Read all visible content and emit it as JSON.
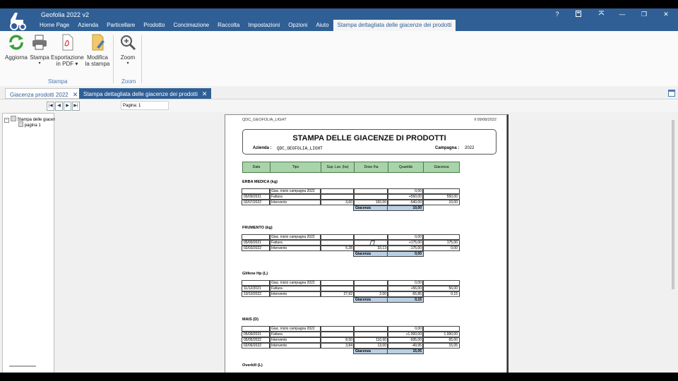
{
  "app": {
    "title": "Geofolia 2022 v2"
  },
  "menu": [
    "Home Page",
    "Azienda",
    "Particellare",
    "Prodotto",
    "Concimazione",
    "Raccolta",
    "Impostazioni",
    "Opzioni",
    "Aiuto",
    "Stampa dettagliata delle giacenze dei prodotti"
  ],
  "window_controls": {
    "help": "?",
    "minimize": "—",
    "restore": "❐",
    "close": "✕"
  },
  "ribbon": {
    "refresh": "Aggiorna",
    "print": "Stampa",
    "export_pdf_1": "Esportazione",
    "export_pdf_2": "in PDF ▾",
    "edit_print_1": "Modifica",
    "edit_print_2": "la stampa",
    "zoom": "Zoom",
    "group_print": "Stampa",
    "group_zoom": "Zoom"
  },
  "tabs": {
    "tab1": "Giacenza prodotti 2022",
    "tab2": "Stampa dettagliata delle giacenze dei prodotti"
  },
  "viewer": {
    "page_label": "Pagina: 1"
  },
  "tree": {
    "root": "Stampa delle giacenze",
    "child": "pagina 1"
  },
  "report": {
    "db_name": "QDC_GEOFOLIA_LIGHT",
    "date": "Il 09/08/2022",
    "title": "STAMPA DELLE GIACENZE DI PRODOTTI",
    "azienda_label": "Azienda :",
    "azienda_value": "QDC_GEOFOLIA_LIGHT",
    "campagna_label": "Campagna :",
    "campagna_value": "2022",
    "columns": [
      "Data",
      "Tipo",
      "Sup. Lav. (ha)",
      "Dose /ha",
      "Quantità",
      "Giacenza"
    ],
    "total_label": "Giacenza",
    "sections": [
      {
        "name": "ERBA MEDICA (kg)",
        "rows": [
          [
            "",
            "Giac. inizio campagna 2022",
            "",
            "",
            "0,00",
            ""
          ],
          [
            "05/09/2021",
            "Fattura",
            "",
            "",
            "+550,00",
            "550,00"
          ],
          [
            "02/07/2022",
            "Intervento",
            "3,60",
            "150,00",
            "-540,00",
            "10,00"
          ]
        ],
        "total": "10,00"
      },
      {
        "name": "FRUMENTO (kg)",
        "rows": [
          [
            "",
            "Giac. inizio campagna 2022",
            "",
            "",
            "0,00",
            ""
          ],
          [
            "05/09/2021",
            "Fattura",
            "",
            "",
            "+175,00",
            "175,00"
          ],
          [
            "02/03/2022",
            "Intervento",
            "5,28",
            "33,13",
            "-175,00",
            "0,00"
          ]
        ],
        "total": "0,00"
      },
      {
        "name": "Glifene Hp (L)",
        "rows": [
          [
            "",
            "Giac. inizio campagna 2022",
            "",
            "",
            "0,00",
            ""
          ],
          [
            "11/12/2021",
            "Fattura",
            "",
            "",
            "+56,00",
            "56,00"
          ],
          [
            "10/10/2022",
            "Intervento",
            "27,92",
            "2,00",
            "-55,85",
            "0,15"
          ]
        ],
        "total": "0,15"
      },
      {
        "name": "MAIS (D)",
        "rows": [
          [
            "",
            "Giac. inizio campagna 2022",
            "",
            "",
            "0,00",
            ""
          ],
          [
            "05/09/2021",
            "Fattura",
            "",
            "",
            "+1.000,00",
            "1.000,00"
          ],
          [
            "05/05/2022",
            "Intervento",
            "8,50",
            "110,00",
            "-935,00",
            "65,00"
          ],
          [
            "02/06/2022",
            "Intervento",
            "3,84",
            "13,00",
            "-49,95",
            "15,05"
          ]
        ],
        "total": "15,05"
      },
      {
        "name": "Overkill (L)",
        "rows": [],
        "total": ""
      }
    ]
  },
  "colors": {
    "titlebar": "#2f5f95",
    "header_green": "#a9d4a9",
    "total_blue": "#b8cfe6"
  }
}
